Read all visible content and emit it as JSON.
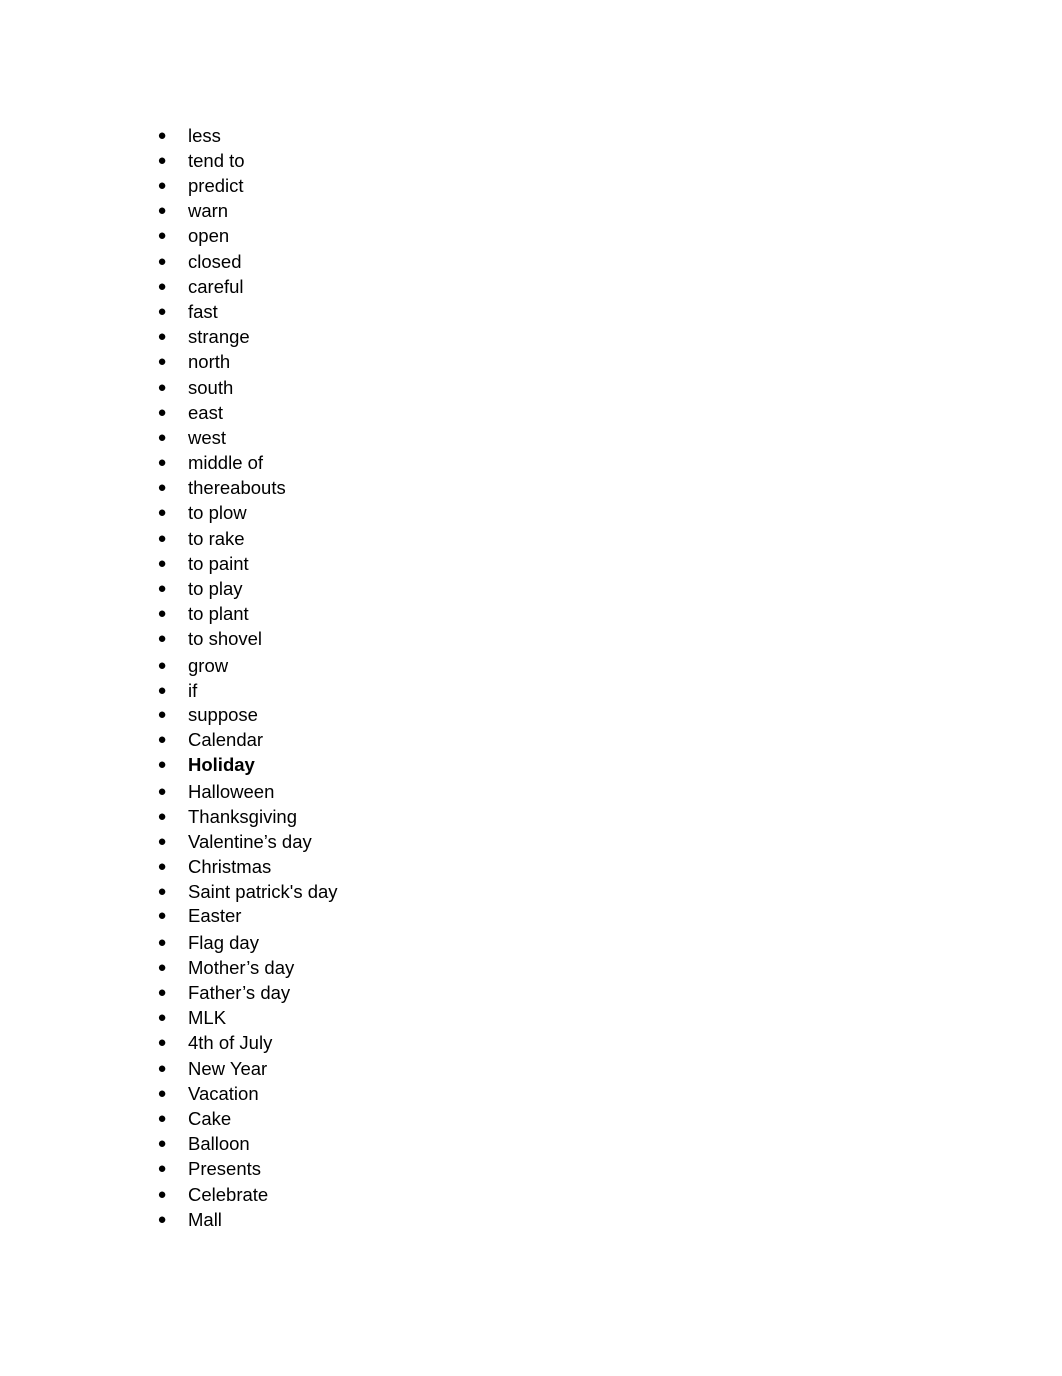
{
  "document": {
    "bullet_symbol": "●",
    "items": [
      {
        "text": "less"
      },
      {
        "text": "tend to"
      },
      {
        "text": "predict"
      },
      {
        "text": "warn"
      },
      {
        "text": "open"
      },
      {
        "text": "closed"
      },
      {
        "text": "careful"
      },
      {
        "text": "fast"
      },
      {
        "text": "strange"
      },
      {
        "text": "north"
      },
      {
        "text": "south"
      },
      {
        "text": "east"
      },
      {
        "text": "west"
      },
      {
        "text": "middle of"
      },
      {
        "text": "thereabouts"
      },
      {
        "text": "to plow"
      },
      {
        "text": "to rake"
      },
      {
        "text": "to paint"
      },
      {
        "text": "to play"
      },
      {
        "text": "to plant"
      },
      {
        "text": "to shovel"
      },
      {
        "text": "grow"
      },
      {
        "text": "if"
      },
      {
        "text": "suppose"
      },
      {
        "text": "Calendar"
      },
      {
        "text": "Holiday",
        "bold": true
      },
      {
        "text": "Halloween"
      },
      {
        "text": "Thanksgiving"
      },
      {
        "text": "Valentine’s day"
      },
      {
        "text": "Christmas"
      },
      {
        "text": "Saint patrick's day"
      },
      {
        "text": "Easter"
      },
      {
        "text": "Flag day"
      },
      {
        "text": "Mother’s day"
      },
      {
        "text": "Father’s day"
      },
      {
        "text": "MLK"
      },
      {
        "text": "4th of July"
      },
      {
        "text": "New Year"
      },
      {
        "text": "Vacation"
      },
      {
        "text": "Cake"
      },
      {
        "text": "Balloon"
      },
      {
        "text": "Presents"
      },
      {
        "text": "Celebrate"
      },
      {
        "text": "Mall"
      }
    ]
  }
}
